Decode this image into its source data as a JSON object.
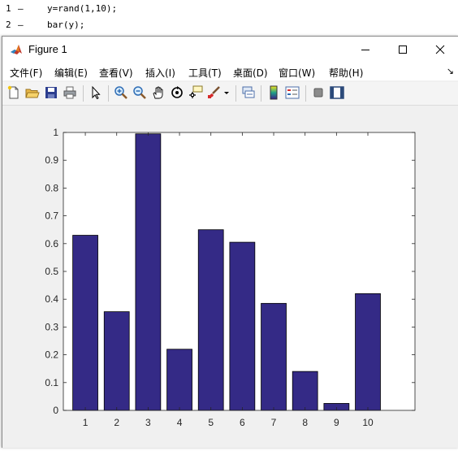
{
  "editor": {
    "lines": [
      {
        "num": "1",
        "dash": "–",
        "code": "y=rand(1,10);"
      },
      {
        "num": "2",
        "dash": "–",
        "code": "bar(y);"
      }
    ]
  },
  "window": {
    "title": "Figure 1",
    "controls": {
      "minimize": "minimize",
      "maximize": "maximize",
      "close": "close"
    }
  },
  "menubar": {
    "items": [
      "文件(F)",
      "编辑(E)",
      "查看(V)",
      "插入(I)",
      "工具(T)",
      "桌面(D)",
      "窗口(W)",
      "帮助(H)"
    ],
    "corner": "↘"
  },
  "toolbar": {
    "icons": [
      "new-figure-icon",
      "open-file-icon",
      "save-icon",
      "print-icon",
      "pointer-icon",
      "zoom-in-icon",
      "zoom-out-icon",
      "pan-hand-icon",
      "rotate-3d-icon",
      "data-cursor-icon",
      "brush-icon",
      "brush-dropdown-icon",
      "link-plot-icon",
      "colorbar-icon",
      "legend-icon",
      "hide-plot-tools-icon",
      "show-plot-tools-icon"
    ]
  },
  "colors": {
    "bar": "#342a86",
    "axes_bg": "#ffffff",
    "figure_bg": "#f0f0f0"
  },
  "chart_data": {
    "type": "bar",
    "categories": [
      "1",
      "2",
      "3",
      "4",
      "5",
      "6",
      "7",
      "8",
      "9",
      "10"
    ],
    "values": [
      0.63,
      0.355,
      0.995,
      0.22,
      0.65,
      0.605,
      0.385,
      0.14,
      0.025,
      0.42
    ],
    "xlim": [
      0.3,
      11.5
    ],
    "ylim": [
      0,
      1
    ],
    "yticks": [
      "0",
      "0.1",
      "0.2",
      "0.3",
      "0.4",
      "0.5",
      "0.6",
      "0.7",
      "0.8",
      "0.9",
      "1"
    ],
    "title": "",
    "xlabel": "",
    "ylabel": "",
    "grid": false
  }
}
